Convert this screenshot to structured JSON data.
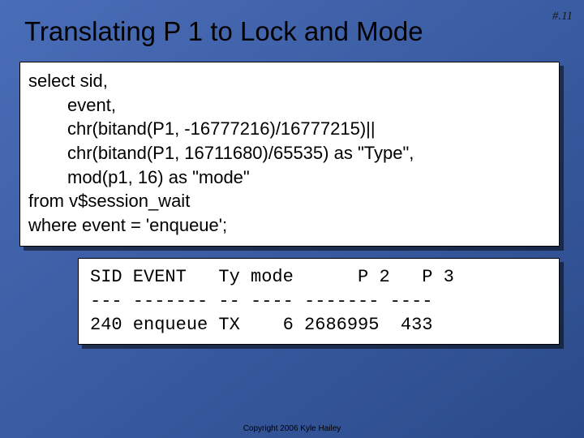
{
  "page_number": "#.11",
  "title": "Translating P 1 to Lock and Mode",
  "sql": {
    "l1": "select sid,",
    "l2": "event,",
    "l3": "chr(bitand(P1, -16777216)/16777215)||",
    "l4": "chr(bitand(P1, 16711680)/65535) as \"Type\",",
    "l5": "mod(p1, 16)  as \"mode\"",
    "l6": "from v$session_wait",
    "l7": "where event = 'enqueue';"
  },
  "result": {
    "header": "SID EVENT   Ty mode      P 2   P 3",
    "sep": "--- ------- -- ---- ------- ----",
    "row": "240 enqueue TX    6 2686995  433"
  },
  "copyright": "Copyright 2006 Kyle Hailey"
}
